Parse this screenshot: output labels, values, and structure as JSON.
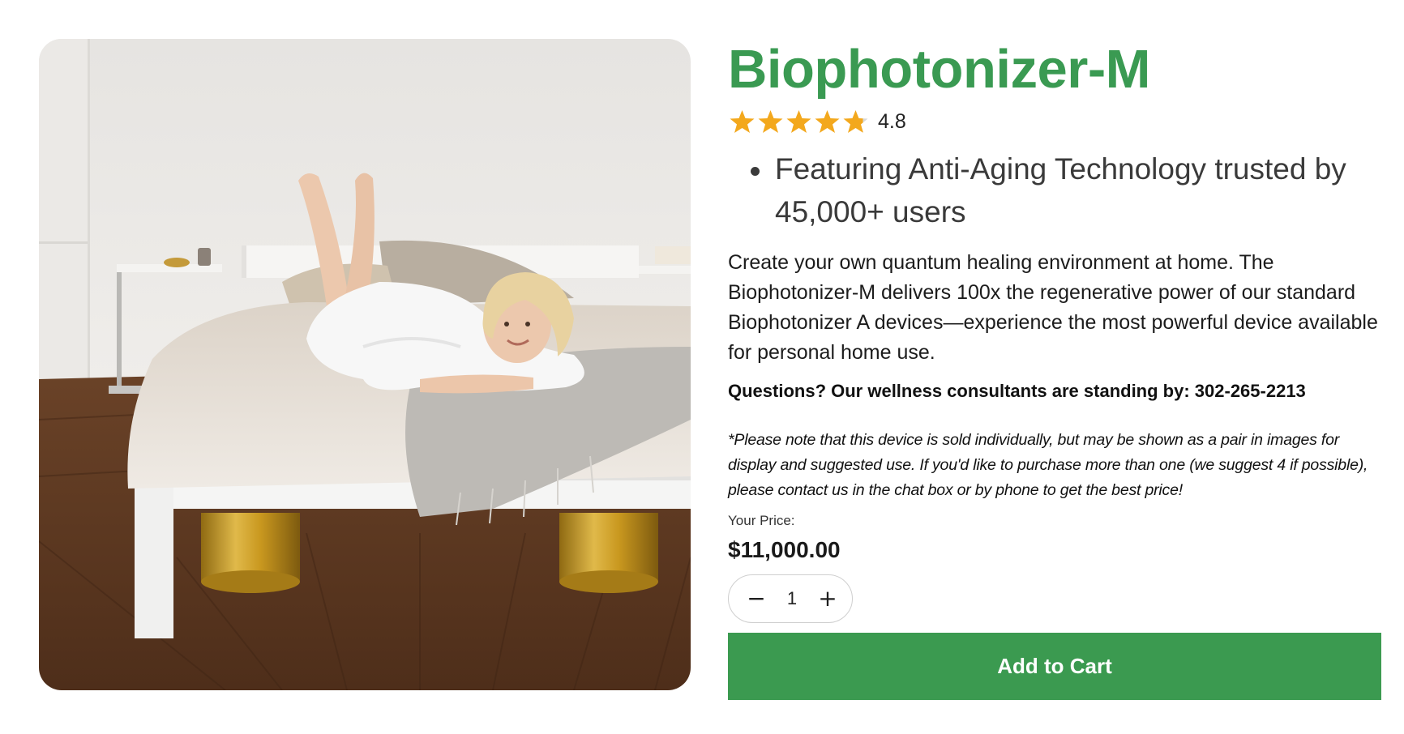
{
  "product": {
    "title": "Biophotonizer-M",
    "rating": 4.8,
    "rating_text": "4.8",
    "rating_max": 5,
    "features": [
      "Featuring Anti-Aging Technology trusted by 45,000+ users"
    ],
    "description": "Create your own quantum healing environment at home. The Biophotonizer-M delivers 100x the regenerative power of our standard Biophotonizer A devices—experience the most powerful device available for personal home use.",
    "questions": "Questions? Our wellness consultants are standing by: 302-265-2213",
    "note": "*Please note that this device is sold individually, but may be shown as a pair in images for display and suggested use. If you'd like to purchase more than one (we suggest 4 if possible), please contact us in the chat box or by phone to get the best price!",
    "price_label": "Your Price:",
    "price": "$11,000.00",
    "quantity": "1",
    "minus_glyph": "−",
    "plus_glyph": "+",
    "add_to_cart_label": "Add to Cart"
  },
  "icons": {
    "star": "star-icon",
    "half_star": "star-half-icon",
    "minus": "minus-icon",
    "plus": "plus-icon"
  },
  "colors": {
    "brand_green": "#3a9a52",
    "button_green": "#3b9a50",
    "star_gold": "#f3a81d",
    "star_empty": "#d8d8d8"
  }
}
